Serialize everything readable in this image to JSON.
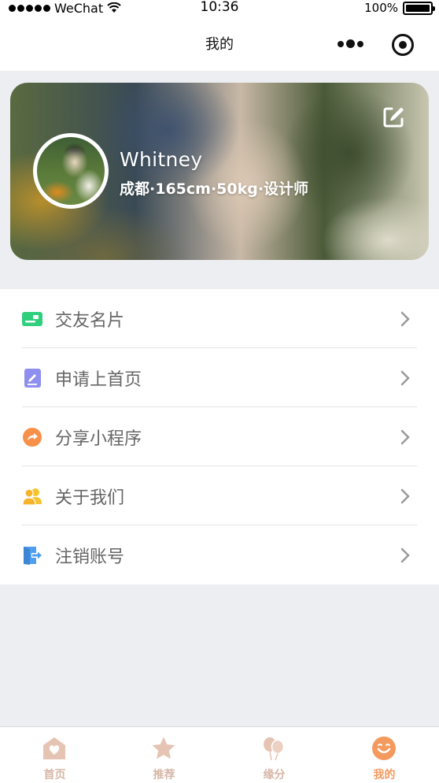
{
  "status_bar": {
    "carrier": "WeChat",
    "time": "10:36",
    "battery": "100%"
  },
  "nav": {
    "title": "我的"
  },
  "profile": {
    "name": "Whitney",
    "info": "成都·165cm·50kg·设计师"
  },
  "menu": [
    {
      "label": "交友名片",
      "icon": "id-card-icon",
      "color": "#2fcf7d"
    },
    {
      "label": "申请上首页",
      "icon": "edit-note-icon",
      "color": "#8f8ff0"
    },
    {
      "label": "分享小程序",
      "icon": "share-icon",
      "color": "#f79149"
    },
    {
      "label": "关于我们",
      "icon": "people-icon",
      "color": "#f5c42f"
    },
    {
      "label": "注销账号",
      "icon": "logout-icon",
      "color": "#4f9ef0"
    }
  ],
  "tabs": [
    {
      "label": "首页",
      "icon": "home-icon",
      "active": false
    },
    {
      "label": "推荐",
      "icon": "star-icon",
      "active": false
    },
    {
      "label": "缘分",
      "icon": "balloon-icon",
      "active": false
    },
    {
      "label": "我的",
      "icon": "smile-icon",
      "active": true
    }
  ],
  "colors": {
    "accent": "#f59a5e",
    "tab_inactive": "#d6b6a6",
    "background": "#eceef2"
  }
}
